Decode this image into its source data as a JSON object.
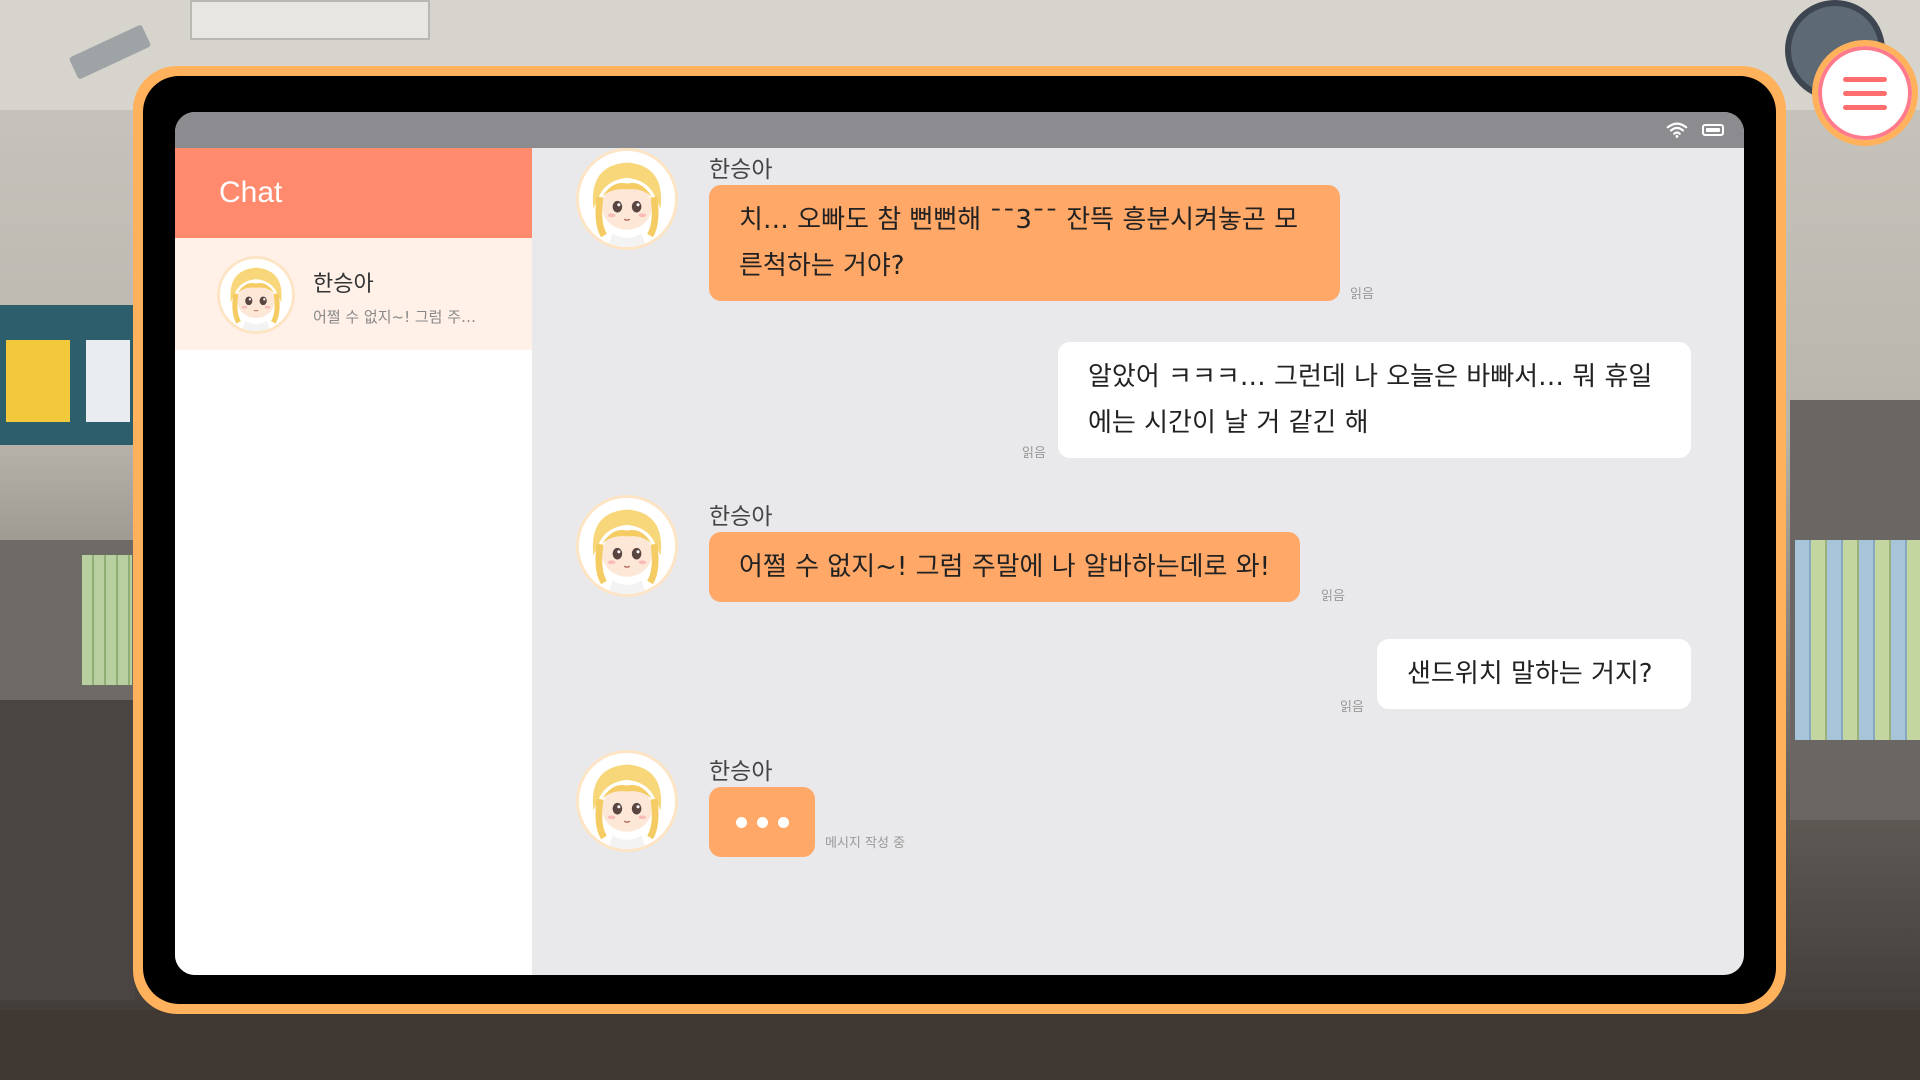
{
  "app": {
    "sidebar_title": "Chat",
    "contacts": [
      {
        "name": "한승아",
        "preview": "어쩔 수 없지~! 그럼 주…",
        "avatar": "anime-girl-avatar-icon"
      }
    ]
  },
  "status_bar": {
    "icons": [
      "wifi-icon",
      "battery-icon"
    ]
  },
  "conversation": {
    "messages": [
      {
        "direction": "in",
        "sender": "한승아",
        "text": "치… 오빠도 참 뻔뻔해 ¯¯3¯¯ 잔뜩 흥분시켜놓곤 모른척하는 거야?",
        "read": "읽음"
      },
      {
        "direction": "out",
        "text": "알았어 ㅋㅋㅋ… 그런데 나 오늘은 바빠서… 뭐 휴일에는 시간이 날 거 같긴 해",
        "read": "읽음"
      },
      {
        "direction": "in",
        "sender": "한승아",
        "text": "어쩔 수 없지~! 그럼 주말에 나 알바하는데로 와!",
        "read": "읽음"
      },
      {
        "direction": "out",
        "text": "샌드위치 말하는 거지?",
        "read": "읽음"
      },
      {
        "direction": "in",
        "sender": "한승아",
        "typing": true,
        "status": "메시지 작성 중"
      }
    ]
  },
  "menu_button": {
    "icon": "hamburger-menu-icon"
  },
  "colors": {
    "tablet_frame": "#ffb15c",
    "header": "#ff8a6e",
    "incoming_bubble": "#ffa868",
    "outgoing_bubble": "#ffffff",
    "chat_bg": "#e9e9ec"
  }
}
